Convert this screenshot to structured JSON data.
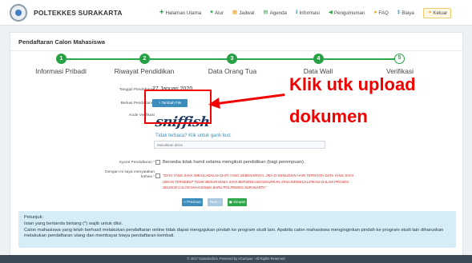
{
  "app": {
    "name": "POLTEKKES SURAKARTA"
  },
  "nav": [
    {
      "icon": "home-icon",
      "glyph": "✚",
      "color": "#2ea74a",
      "label": "Halaman Utama"
    },
    {
      "icon": "workflow-icon",
      "glyph": "♥",
      "color": "#2ea74a",
      "label": "Alur"
    },
    {
      "icon": "calendar-icon",
      "glyph": "▦",
      "color": "#e8a21b",
      "label": "Jadwal"
    },
    {
      "icon": "agenda-icon",
      "glyph": "▤",
      "color": "#2ea74a",
      "label": "Agenda"
    },
    {
      "icon": "info-icon",
      "glyph": "ℹ",
      "color": "#3c8dbc",
      "label": "Informasi"
    },
    {
      "icon": "announcement-icon",
      "glyph": "◀",
      "color": "#2ea74a",
      "label": "Pengumuman"
    },
    {
      "icon": "faq-icon",
      "glyph": "●",
      "color": "#e8a21b",
      "label": "FAQ"
    },
    {
      "icon": "cost-icon",
      "glyph": "$",
      "color": "#3c8dbc",
      "label": "Biaya"
    },
    {
      "icon": "logout-icon",
      "glyph": "⇥",
      "color": "#e8a21b",
      "label": "Keluar"
    }
  ],
  "page": {
    "title": "Pendaftaran Calon Mahasiswa"
  },
  "steps": [
    {
      "number": "1",
      "label": "Informasi Pribadi",
      "state": "done"
    },
    {
      "number": "2",
      "label": "Riwayat Pendidikan",
      "state": "done"
    },
    {
      "number": "3",
      "label": "Data Orang Tua",
      "state": "done"
    },
    {
      "number": "4",
      "label": "Data Wali",
      "state": "done"
    },
    {
      "number": "5",
      "label": "Verifikasi",
      "state": "current"
    }
  ],
  "form": {
    "date_label": "Tanggal Pendaftaran",
    "date_value": "27 Januari 2020",
    "files_label": "Berkas Pendaftaran",
    "upload_button": "Tambah File",
    "captcha_label": "Kode Verifikasi",
    "captcha_text": "sniffish",
    "captcha_refresh": "Tidak terbaca? Klik untuk ganti text.",
    "captcha_placeholder": "Masukkan disini",
    "terms_label": "Syarat Pendaftaran *",
    "terms_text": "Bersedia tidak hamil selama mengikuti pendidikan (bagi perempuan).",
    "declaration_label": "Dengan ini saya menyatakan bahwa *",
    "declaration_text": "\"DATA YANG SAYA ISIKAN ADALAH DATA YANG SEBENARNYA, JIKA DI KEMUDIAN HARI TERNYATA DATA YANG SAYA ISIKAN TERSEBUT TIDAK BENAR MAKA SAYA BERSEDIA DIGUGURKAN ATAU DIDISKUALIFIKASI DALAM PROSES SELEKSI CALON MAHASISWA BARU POLTEKKES SURAKARTA\"",
    "prev_button": "« Previous",
    "next_button": "Next »",
    "save_button": "Simpan"
  },
  "help": {
    "title": "Petunjuk:",
    "line1": "Isian yang bertanda bintang (*) wajib untuk diisi.",
    "line2": "Calon mahasiswa yang telah berhasil melakukan pendaftaran online tidak dapat mengajukan pindah ke program studi lain. Apabila calon mahasiswa menginginkan pindah ke program studi lain diharuskan melakukan pendaftaran ulang dan membayar biaya pendaftaran kembali."
  },
  "footer": {
    "text": "© 2017 Gamaluches. Powered by eCampus - All Rights Reserved"
  },
  "annotation": {
    "line1": "Klik utk upload",
    "line2": "dokumen",
    "color": "#f10000"
  }
}
